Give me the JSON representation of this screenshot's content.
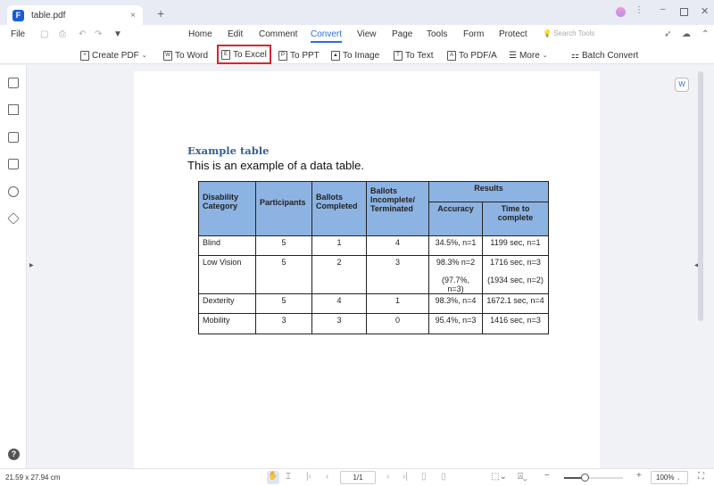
{
  "tab": {
    "title": "table.pdf",
    "close": "×",
    "new": "+"
  },
  "menu": {
    "file": "File",
    "items": [
      "Home",
      "Edit",
      "Comment",
      "Convert",
      "View",
      "Page",
      "Tools",
      "Form",
      "Protect"
    ],
    "search_placeholder": "Search Tools"
  },
  "toolbar": {
    "create_pdf": "Create PDF",
    "to_word": "To Word",
    "to_excel": "To Excel",
    "to_ppt": "To PPT",
    "to_image": "To Image",
    "to_text": "To Text",
    "to_pdfa": "To PDF/A",
    "more": "More",
    "batch": "Batch Convert"
  },
  "doc": {
    "heading": "Example table",
    "intro": "This is an example of a data table.",
    "headers": {
      "category": "Disability Category",
      "participants": "Participants",
      "completed": "Ballots Completed",
      "incomplete": "Ballots Incomplete/ Terminated",
      "results": "Results",
      "accuracy": "Accuracy",
      "time": "Time to complete"
    },
    "rows": [
      {
        "category": "Blind",
        "participants": "5",
        "completed": "1",
        "incomplete": "4",
        "accuracy": "34.5%, n=1",
        "time": "1199 sec, n=1"
      },
      {
        "category": "Low Vision",
        "participants": "5",
        "completed": "2",
        "incomplete": "3",
        "accuracy": "98.3% n=2",
        "accuracy2": "(97.7%, n=3)",
        "time": "1716 sec, n=3",
        "time2": "(1934 sec, n=2)"
      },
      {
        "category": "Dexterity",
        "participants": "5",
        "completed": "4",
        "incomplete": "1",
        "accuracy": "98.3%, n=4",
        "time": "1672.1 sec, n=4"
      },
      {
        "category": "Mobility",
        "participants": "3",
        "completed": "3",
        "incomplete": "0",
        "accuracy": "95.4%, n=3",
        "time": "1416 sec, n=3"
      }
    ]
  },
  "status": {
    "dimensions": "21.59 x 27.94 cm",
    "page": "1/1",
    "zoom": "100%",
    "zoom_level": 0.35
  }
}
